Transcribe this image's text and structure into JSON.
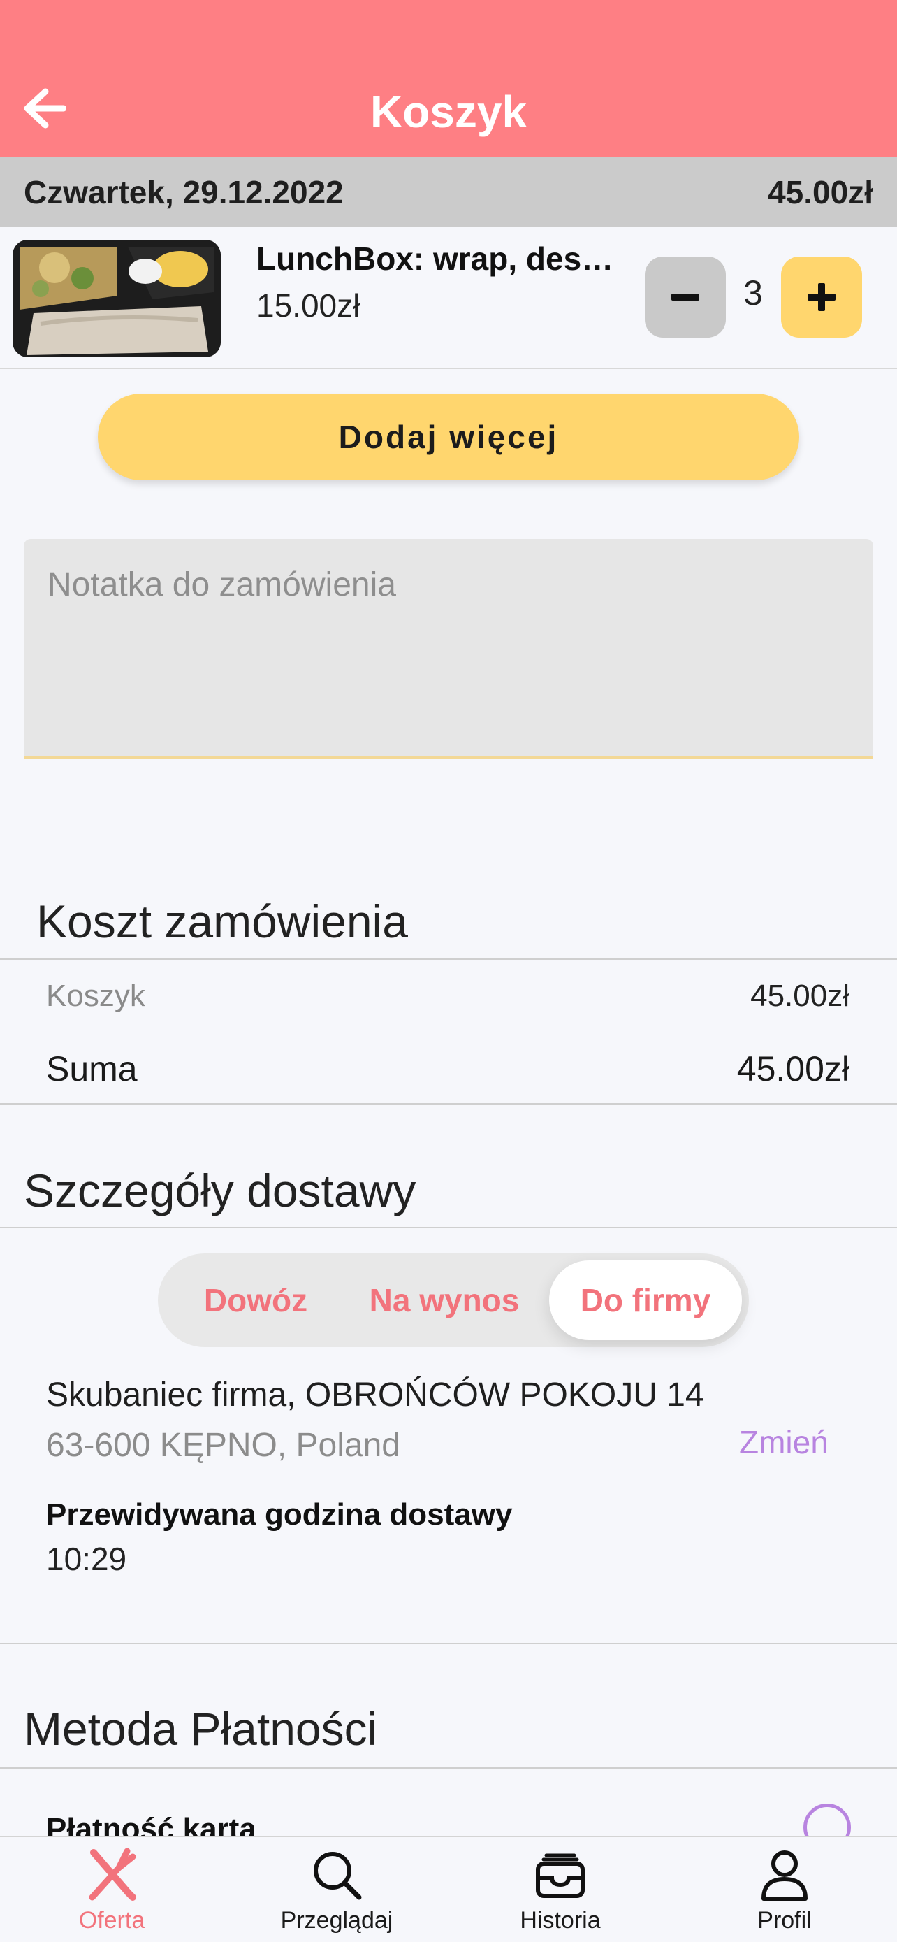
{
  "header": {
    "title": "Koszyk"
  },
  "date_bar": {
    "date": "Czwartek, 29.12.2022",
    "total": "45.00zł"
  },
  "cart_item": {
    "name": "LunchBox: wrap, des…",
    "price": "15.00zł",
    "quantity": "3"
  },
  "add_more": {
    "label": "Dodaj więcej"
  },
  "note": {
    "placeholder": "Notatka do zamówienia"
  },
  "order_cost": {
    "title": "Koszt zamówienia",
    "cart_label": "Koszyk",
    "cart_value": "45.00zł",
    "sum_label": "Suma",
    "sum_value": "45.00zł"
  },
  "delivery": {
    "title": "Szczegóły dostawy",
    "options": [
      "Dowóz",
      "Na wynos",
      "Do firmy"
    ],
    "selected": "Do firmy",
    "address_line1": "Skubaniec firma, OBROŃCÓW POKOJU 14",
    "address_line2": "63-600 KĘPNO, Poland",
    "change_label": "Zmień",
    "eta_label": "Przewidywana godzina dostawy",
    "eta_value": "10:29"
  },
  "payment": {
    "title": "Metoda Płatności",
    "option_label": "Płatność kartą"
  },
  "tabs": [
    {
      "label": "Oferta",
      "icon": "fork-knife-icon",
      "active": true
    },
    {
      "label": "Przeglądaj",
      "icon": "search-icon",
      "active": false
    },
    {
      "label": "Historia",
      "icon": "inbox-icon",
      "active": false
    },
    {
      "label": "Profil",
      "icon": "user-icon",
      "active": false
    }
  ],
  "colors": {
    "accent": "#fe7f84",
    "yellow": "#ffd66e",
    "purple": "#b884e0"
  }
}
